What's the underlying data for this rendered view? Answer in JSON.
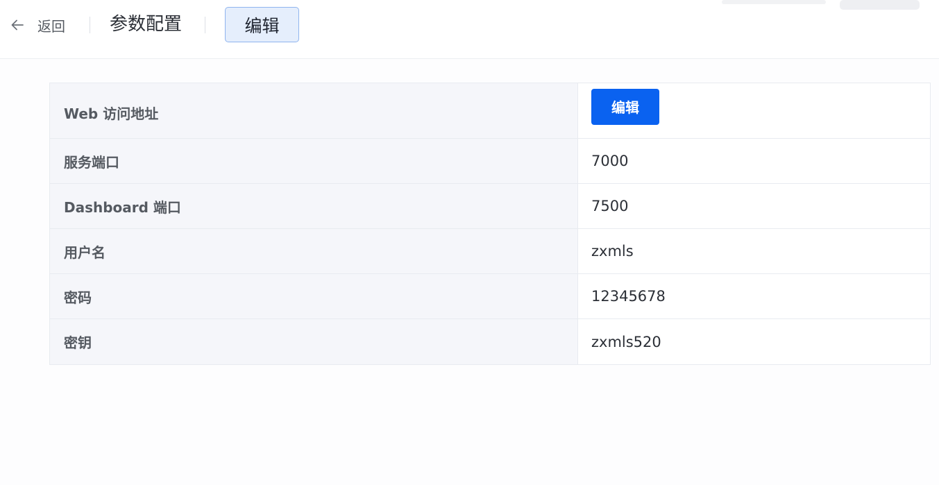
{
  "header": {
    "back_label": "返回",
    "title": "参数配置",
    "edit_label": "编辑"
  },
  "config": {
    "rows": [
      {
        "label": "Web 访问地址",
        "action_label": "编辑"
      },
      {
        "label": "服务端口",
        "value": "7000"
      },
      {
        "label": "Dashboard 端口",
        "value": "7500"
      },
      {
        "label": "用户名",
        "value": "zxmls"
      },
      {
        "label": "密码",
        "value": "12345678"
      },
      {
        "label": "密钥",
        "value": "zxmls520"
      }
    ]
  },
  "colors": {
    "primary": "#0a62f0",
    "header_edit_bg": "#e5eefc",
    "label_bg": "#f5f6fa"
  },
  "icons": {
    "back": "arrow-left-icon"
  }
}
